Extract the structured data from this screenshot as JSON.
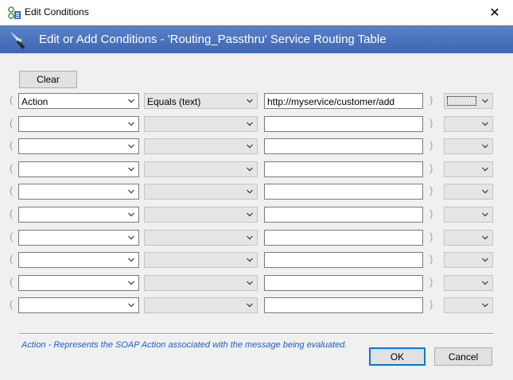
{
  "window": {
    "title": "Edit Conditions",
    "close_glyph": "✕"
  },
  "banner": {
    "title": "Edit or Add Conditions - 'Routing_Passthru' Service Routing Table",
    "icon": "wand-icon"
  },
  "toolbar": {
    "clear_label": "Clear"
  },
  "parens": {
    "open": "(",
    "close": ")"
  },
  "rows": [
    {
      "field": "Action",
      "operator": "Equals (text)",
      "value": "http://myservice/customer/add",
      "logic": ""
    },
    {
      "field": "",
      "operator": "",
      "value": "",
      "logic": ""
    },
    {
      "field": "",
      "operator": "",
      "value": "",
      "logic": ""
    },
    {
      "field": "",
      "operator": "",
      "value": "",
      "logic": ""
    },
    {
      "field": "",
      "operator": "",
      "value": "",
      "logic": ""
    },
    {
      "field": "",
      "operator": "",
      "value": "",
      "logic": ""
    },
    {
      "field": "",
      "operator": "",
      "value": "",
      "logic": ""
    },
    {
      "field": "",
      "operator": "",
      "value": "",
      "logic": ""
    },
    {
      "field": "",
      "operator": "",
      "value": "",
      "logic": ""
    },
    {
      "field": "",
      "operator": "",
      "value": "",
      "logic": ""
    }
  ],
  "help_text": "Action - Represents the SOAP Action associated with the message being evaluated.",
  "buttons": {
    "ok_label": "OK",
    "cancel_label": "Cancel"
  },
  "colors": {
    "banner": "#4a72bd",
    "accent": "#0078d7",
    "help_text": "#1f5fbf"
  }
}
